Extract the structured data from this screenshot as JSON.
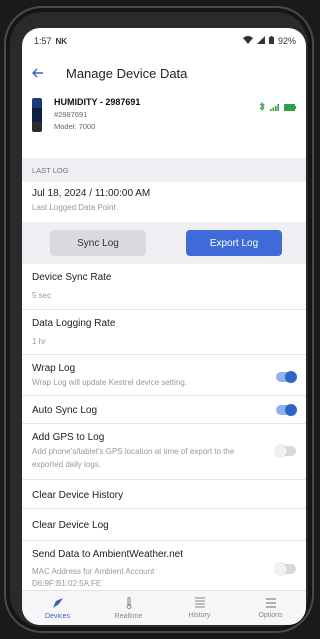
{
  "status": {
    "time": "1:57",
    "carrier_icon": "NK",
    "battery": "92%"
  },
  "header": {
    "title": "Manage Device Data"
  },
  "device": {
    "name": "HUMIDITY - 2987691",
    "serial": "#2987691",
    "model": "Model: 7000"
  },
  "section": {
    "label": "LAST LOG"
  },
  "last_log": {
    "value": "Jul 18, 2024 / 11:00:00 AM",
    "caption": "Last Logged Data Point"
  },
  "buttons": {
    "sync": "Sync Log",
    "export": "Export Log"
  },
  "rows": {
    "sync_rate": {
      "title": "Device Sync Rate",
      "value": "5 sec"
    },
    "logging_rate": {
      "title": "Data Logging Rate",
      "value": "1 hr"
    },
    "wrap": {
      "title": "Wrap Log",
      "desc": "Wrap Log will update Kestrel device setting.",
      "on": true
    },
    "auto_sync": {
      "title": "Auto Sync Log",
      "on": true
    },
    "gps": {
      "title": "Add GPS to Log",
      "desc": "Add phone's/tablet's GPS location at time of export to the exported daily logs.",
      "on": false
    },
    "clear_history": {
      "title": "Clear Device History"
    },
    "clear_log": {
      "title": "Clear Device Log"
    },
    "ambient": {
      "title": "Send Data to AmbientWeather.net",
      "desc1": "MAC Address for Ambient Account",
      "desc2": "D6:9F:B1:02:5A:FE",
      "on": false
    }
  },
  "nav": [
    {
      "label": "Devices",
      "icon": "devices-icon",
      "active": true
    },
    {
      "label": "Realtime",
      "icon": "thermometer-icon"
    },
    {
      "label": "History",
      "icon": "list-icon"
    },
    {
      "label": "Options",
      "icon": "menu-icon"
    }
  ],
  "colors": {
    "accent": "#3f6ad8",
    "bluetooth": "#2e9e4a"
  }
}
